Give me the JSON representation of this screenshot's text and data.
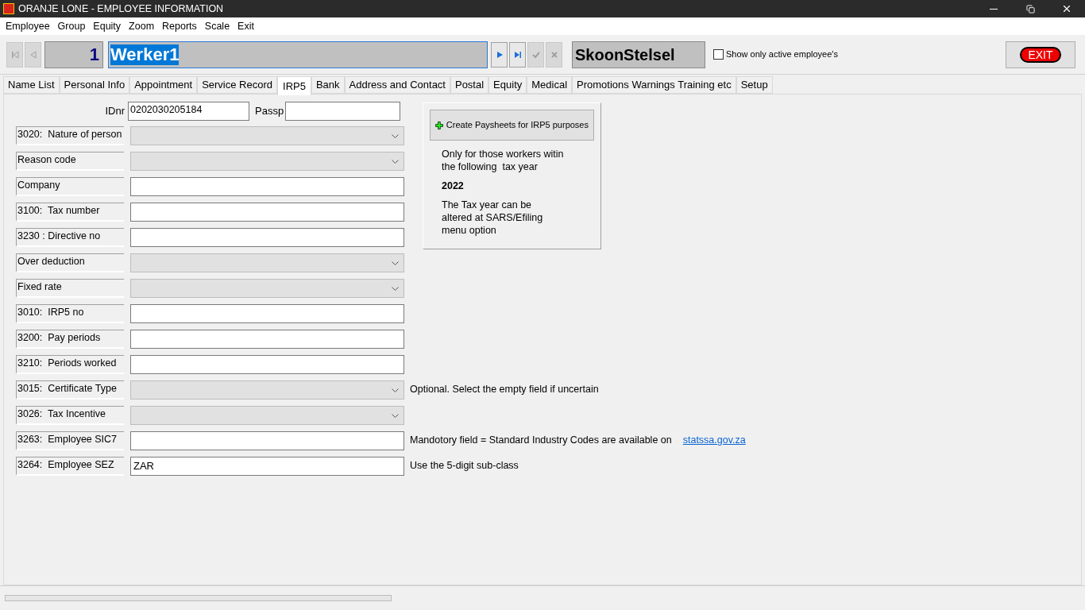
{
  "window": {
    "title": "ORANJE LONE - EMPLOYEE INFORMATION"
  },
  "menu": [
    "Employee",
    "Group",
    "Equity",
    "Zoom",
    "Reports",
    "Scale",
    "Exit"
  ],
  "toolbar": {
    "nav_left": [
      {
        "kind": "first",
        "disabled": true
      },
      {
        "kind": "prev",
        "disabled": true
      }
    ],
    "number": "1",
    "name": "Werker1",
    "name_selected": true,
    "nav_right": [
      {
        "kind": "next",
        "disabled": false
      },
      {
        "kind": "last",
        "disabled": false
      },
      {
        "kind": "confirm",
        "disabled": true
      },
      {
        "kind": "cancel",
        "disabled": true
      }
    ],
    "company": "SkoonStelsel",
    "active_only": {
      "label": "Show only active employee's",
      "checked": false
    },
    "exit": "EXIT"
  },
  "tabs": [
    {
      "label": "Name List",
      "selected": false
    },
    {
      "label": "Personal Info",
      "selected": false
    },
    {
      "label": "Appointment",
      "selected": false
    },
    {
      "label": "Service Record",
      "selected": false
    },
    {
      "label": "IRP5",
      "selected": true
    },
    {
      "label": "Bank",
      "selected": false
    },
    {
      "label": "Address and Contact",
      "selected": false
    },
    {
      "label": "Postal",
      "selected": false
    },
    {
      "label": "Equity",
      "selected": false
    },
    {
      "label": "Medical",
      "selected": false
    },
    {
      "label": "Promotions Warnings Training etc",
      "selected": false
    },
    {
      "label": "Setup",
      "selected": false
    }
  ],
  "id_row": {
    "id_label": "IDnr",
    "id_value": "0202030205184",
    "passport_label": "Passp"
  },
  "fields": [
    {
      "label": "3020:  Nature of person",
      "kind": "select"
    },
    {
      "label": "Reason code",
      "kind": "select"
    },
    {
      "label": "Company",
      "kind": "text"
    },
    {
      "label": "3100:  Tax number",
      "kind": "text"
    },
    {
      "label": "3230 : Directive no",
      "kind": "text"
    },
    {
      "label": "Over deduction",
      "kind": "select"
    },
    {
      "label": "Fixed rate",
      "kind": "select"
    },
    {
      "label": "3010:  IRP5 no",
      "kind": "text"
    },
    {
      "label": "3200:  Pay periods",
      "kind": "text"
    },
    {
      "label": "3210:  Periods worked",
      "kind": "text"
    },
    {
      "label": "3015:  Certificate Type",
      "kind": "select",
      "note": "Optional. Select the empty field if uncertain"
    },
    {
      "label": "3026:  Tax Incentive",
      "kind": "select"
    },
    {
      "label": "3263:  Employee SIC7",
      "kind": "text",
      "note": "Mandotory field = Standard Industry Codes are available on",
      "link": "statssa.gov.za"
    },
    {
      "label": "3264:  Employee SEZ",
      "kind": "text",
      "value": "ZAR",
      "note": "Use the 5-digit sub-class"
    }
  ],
  "paysheet_panel": {
    "button": "Create Paysheets for IRP5 purposes",
    "text1": "Only for those workers witin the following  tax year",
    "year": "2022",
    "text2": "The Tax year can be altered at SARS/Efiling menu option"
  },
  "status_bar": {
    "progress_visible": true
  }
}
